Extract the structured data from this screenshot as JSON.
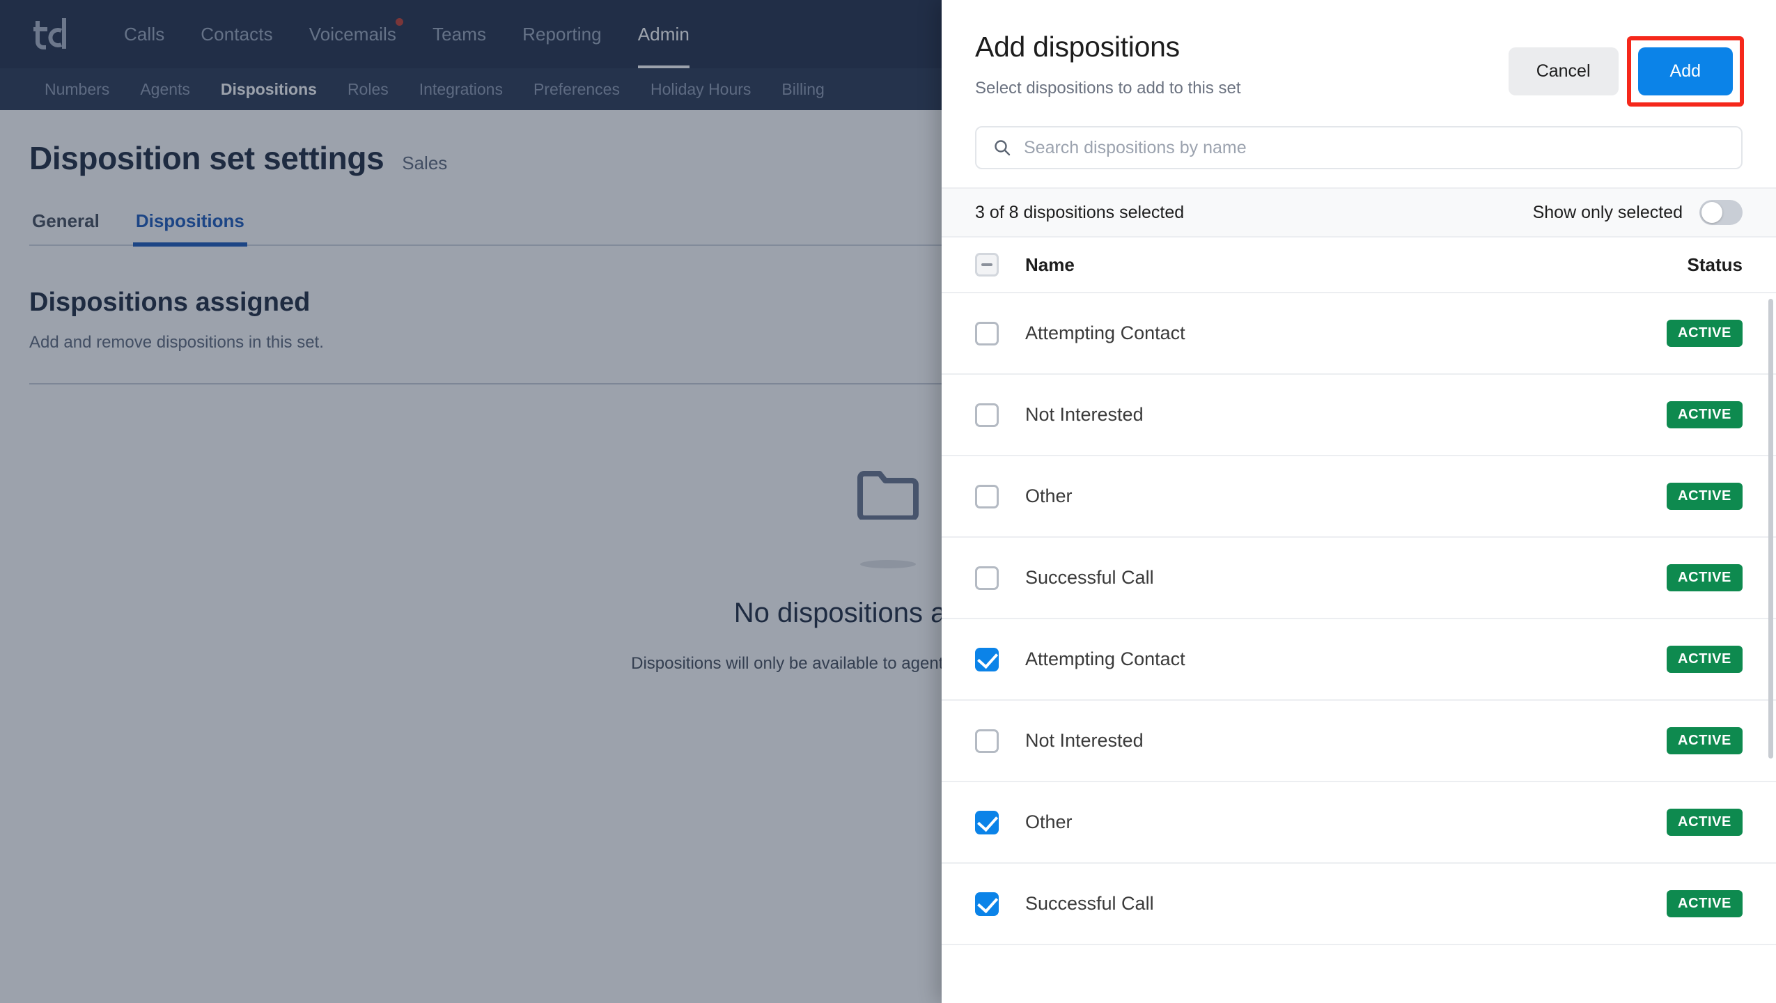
{
  "topnav": {
    "logo_alt": "td-logo",
    "items": [
      {
        "label": "Calls",
        "active": false,
        "badge": false
      },
      {
        "label": "Contacts",
        "active": false,
        "badge": false
      },
      {
        "label": "Voicemails",
        "active": false,
        "badge": true
      },
      {
        "label": "Teams",
        "active": false,
        "badge": false
      },
      {
        "label": "Reporting",
        "active": false,
        "badge": false
      },
      {
        "label": "Admin",
        "active": true,
        "badge": false
      }
    ]
  },
  "subnav": {
    "items": [
      {
        "label": "Numbers",
        "active": false
      },
      {
        "label": "Agents",
        "active": false
      },
      {
        "label": "Dispositions",
        "active": true
      },
      {
        "label": "Roles",
        "active": false
      },
      {
        "label": "Integrations",
        "active": false
      },
      {
        "label": "Preferences",
        "active": false
      },
      {
        "label": "Holiday Hours",
        "active": false
      },
      {
        "label": "Billing",
        "active": false
      }
    ]
  },
  "page": {
    "title": "Disposition set settings",
    "subtitle": "Sales",
    "tabs": [
      {
        "label": "General",
        "active": false
      },
      {
        "label": "Dispositions",
        "active": true
      }
    ],
    "section_title": "Dispositions assigned",
    "section_desc": "Add and remove dispositions in this set.",
    "empty_icon": "folder-icon",
    "empty_title": "No dispositions assigned",
    "empty_sub": "Dispositions will only be available to agents once assigned to this set."
  },
  "modal": {
    "title": "Add dispositions",
    "subtitle": "Select dispositions to add to this set",
    "cancel_label": "Cancel",
    "add_label": "Add",
    "add_highlight_color": "#f5281b",
    "add_button_color": "#0b83e8",
    "search": {
      "icon": "search-icon",
      "placeholder": "Search dispositions by name",
      "value": ""
    },
    "select_bar": {
      "count_text": "3 of 8 dispositions selected",
      "toggle_label": "Show only selected",
      "toggle_on": false
    },
    "table": {
      "headers": {
        "name": "Name",
        "status": "Status"
      },
      "header_checkbox_state": "indeterminate",
      "rows": [
        {
          "name": "Attempting Contact",
          "status": "ACTIVE",
          "checked": false
        },
        {
          "name": "Not Interested",
          "status": "ACTIVE",
          "checked": false
        },
        {
          "name": "Other",
          "status": "ACTIVE",
          "checked": false
        },
        {
          "name": "Successful Call",
          "status": "ACTIVE",
          "checked": false
        },
        {
          "name": "Attempting Contact",
          "status": "ACTIVE",
          "checked": true
        },
        {
          "name": "Not Interested",
          "status": "ACTIVE",
          "checked": false
        },
        {
          "name": "Other",
          "status": "ACTIVE",
          "checked": true
        },
        {
          "name": "Successful Call",
          "status": "ACTIVE",
          "checked": true
        }
      ],
      "status_badge_color": "#0e8a4f"
    }
  }
}
